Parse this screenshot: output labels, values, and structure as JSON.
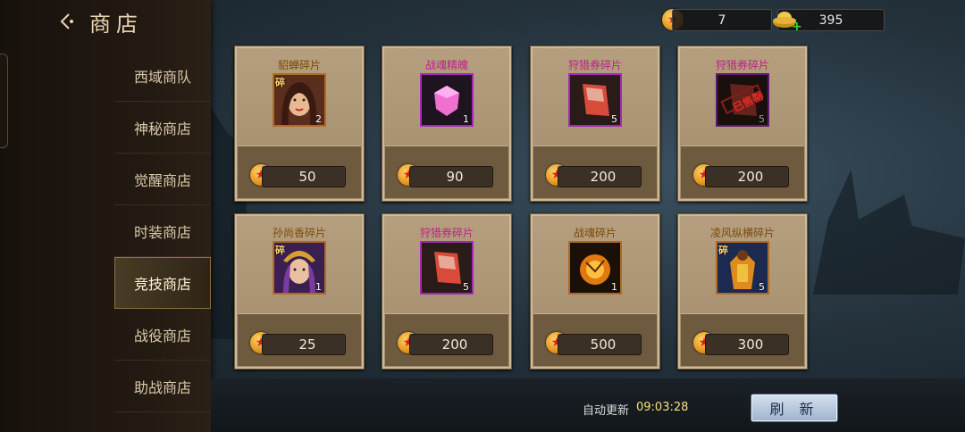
{
  "header": {
    "title": "商店"
  },
  "sidebar": {
    "items": [
      {
        "label": "西域商队"
      },
      {
        "label": "神秘商店"
      },
      {
        "label": "觉醒商店"
      },
      {
        "label": "时装商店"
      },
      {
        "label": "竞技商店"
      },
      {
        "label": "战役商店"
      },
      {
        "label": "助战商店"
      }
    ],
    "active": "竞技商店"
  },
  "currency": {
    "coins": "7",
    "ingots": "395"
  },
  "shop": {
    "items": [
      {
        "name": "貂蝉碎片",
        "qty": "2",
        "price": "50",
        "frag": "碎",
        "icon": "hero-portrait-icon"
      },
      {
        "name": "战魂精魄",
        "qty": "1",
        "price": "90",
        "frag": "",
        "icon": "pink-gem-icon"
      },
      {
        "name": "狩猎券碎片",
        "qty": "5",
        "price": "200",
        "frag": "",
        "icon": "ticket-icon"
      },
      {
        "name": "狩猎券碎片",
        "qty": "5",
        "price": "200",
        "frag": "",
        "icon": "sold-ticket-icon",
        "stamp": "已售罄"
      },
      {
        "name": "孙尚香碎片",
        "qty": "1",
        "price": "25",
        "frag": "碎",
        "icon": "hero-portrait-icon"
      },
      {
        "name": "狩猎券碎片",
        "qty": "5",
        "price": "200",
        "frag": "",
        "icon": "ticket-icon"
      },
      {
        "name": "战魂碎片",
        "qty": "1",
        "price": "500",
        "frag": "",
        "icon": "soul-orb-icon"
      },
      {
        "name": "凌风纵横碎片",
        "qty": "5",
        "price": "300",
        "frag": "碎",
        "icon": "costume-icon"
      }
    ]
  },
  "footer": {
    "auto_refresh_label": "自动更新",
    "auto_refresh_time": "09:03:28",
    "refresh_button": "刷 新"
  },
  "colors": {
    "accent_gold": "#f5e07a",
    "name_pink": "#c0208a",
    "name_brown": "#7a4a08",
    "active_tab": "#4a3c25"
  }
}
